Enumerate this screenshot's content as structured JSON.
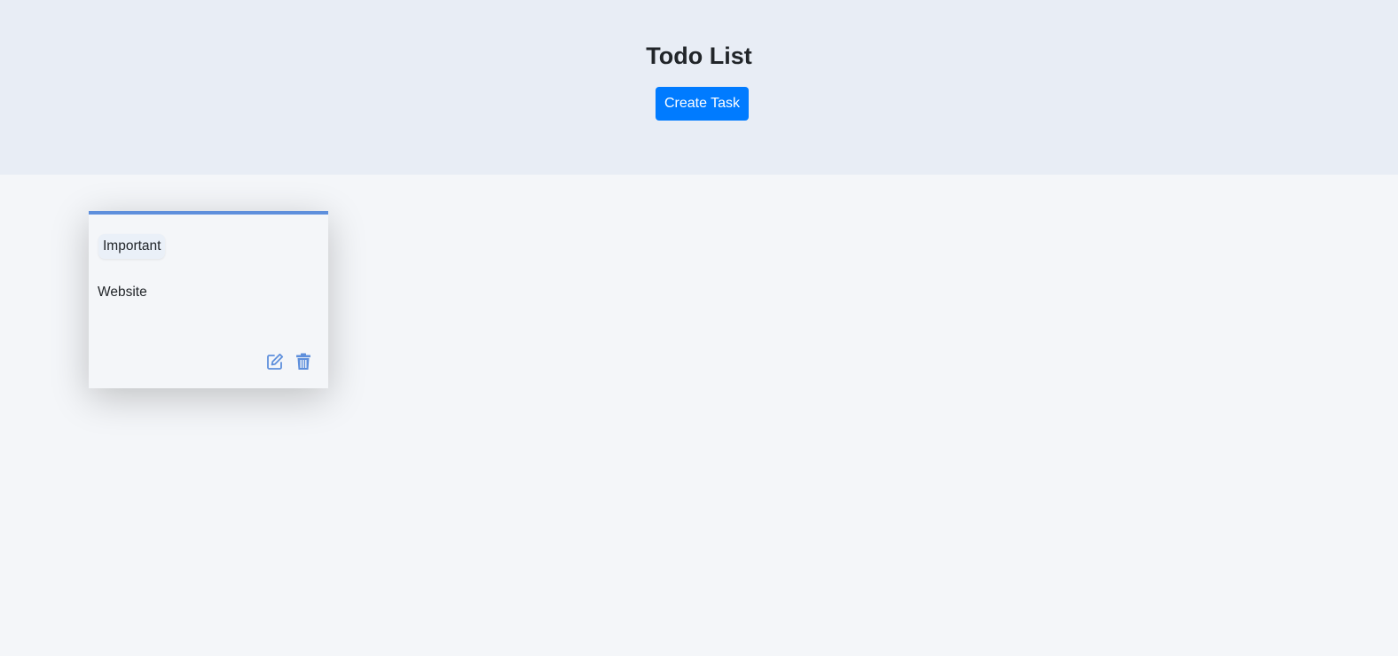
{
  "header": {
    "title": "Todo List",
    "create_button_label": "Create Task"
  },
  "tasks": [
    {
      "tag": "Important",
      "description": "Website",
      "actions": [
        "edit-icon",
        "trash-icon"
      ]
    }
  ],
  "colors": {
    "header_bg": "#e8edf5",
    "page_bg": "#f4f6f9",
    "primary": "#007bff",
    "card_accent": "#5e8fdc"
  }
}
